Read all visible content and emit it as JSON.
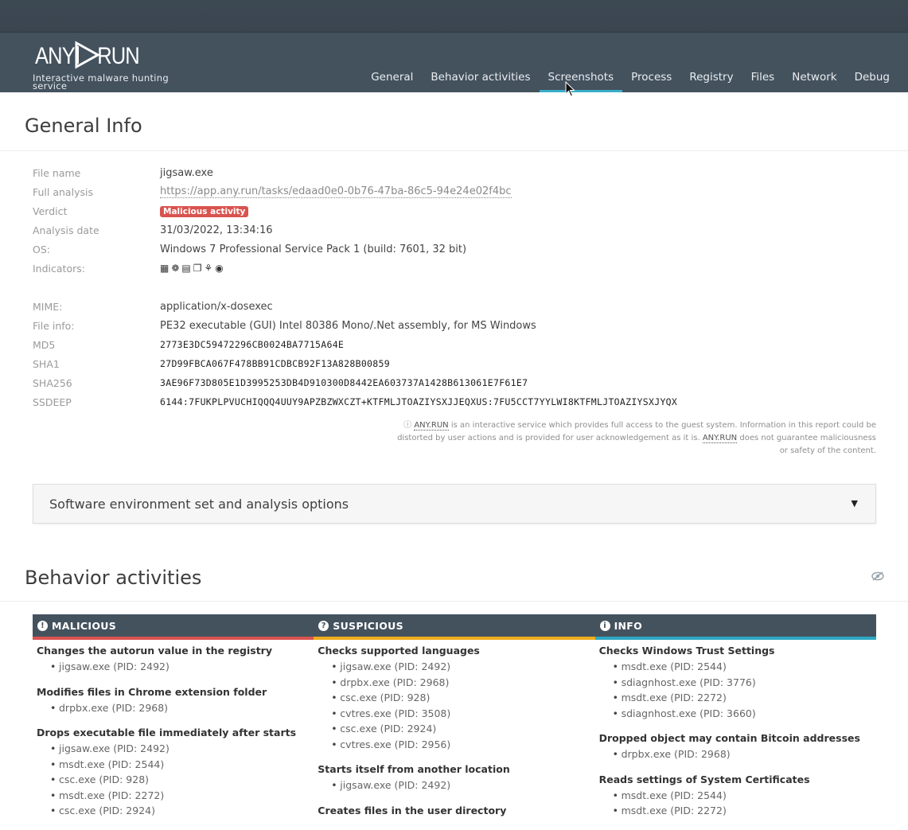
{
  "header": {
    "logo_text": "ANY RUN",
    "tagline_line1": "Interactive malware hunting",
    "tagline_line2": "service",
    "nav": [
      "General",
      "Behavior activities",
      "Screenshots",
      "Process",
      "Registry",
      "Files",
      "Network",
      "Debug"
    ],
    "active_nav": "Screenshots"
  },
  "general": {
    "title": "General Info",
    "rows": [
      {
        "label": "File name",
        "value": "jigsaw.exe"
      },
      {
        "label": "Full analysis",
        "value": "https://app.any.run/tasks/edaad0e0-0b76-47ba-86c5-94e24e02f4bc"
      },
      {
        "label": "Verdict",
        "value": "Malicious activity"
      },
      {
        "label": "Analysis date",
        "value": "31/03/2022, 13:34:16"
      },
      {
        "label": "OS:",
        "value": "Windows 7 Professional Service Pack 1 (build: 7601, 32 bit)"
      },
      {
        "label": "Indicators:",
        "value": ""
      },
      {
        "label": "MIME:",
        "value": "application/x-dosexec"
      },
      {
        "label": "File info:",
        "value": "PE32 executable (GUI) Intel 80386 Mono/.Net assembly, for MS Windows"
      },
      {
        "label": "MD5",
        "value": "2773E3DC59472296CB0024BA7715A64E"
      },
      {
        "label": "SHA1",
        "value": "27D99FBCA067F478BB91CDBCB92F13A828B00859"
      },
      {
        "label": "SHA256",
        "value": "3AE96F73D805E1D3995253DB4D910300D8442EA603737A1428B613061E7F61E7"
      },
      {
        "label": "SSDEEP",
        "value": "6144:7FUKPLPVUCHIQQQ4UUY9APZBZWXCZT+KTFMLJTOAZIYSXJJEQXUS:7FU5CCT7YYLWI8KTFMLJTOAZIYSXJYQX"
      }
    ],
    "indicator_icons": [
      "network-icon",
      "bug-icon",
      "executable-icon",
      "files-icon",
      "spy-icon",
      "eye-icon"
    ],
    "disclaimer_brand": "ANY.RUN",
    "disclaimer_part1": "is an interactive service which provides full access to the guest system. Information in this report could be distorted by user actions and is provided for user acknowledgement as it is.",
    "disclaimer_part2": "does not guarantee maliciousness or safety of the content."
  },
  "accordion": {
    "label": "Software environment set and analysis options"
  },
  "behavior": {
    "title": "Behavior activities",
    "columns": [
      {
        "title": "MALICIOUS",
        "icon": "!",
        "color": "#d9534f",
        "groups": [
          {
            "title": "Changes the autorun value in the registry",
            "items": [
              "jigsaw.exe (PID: 2492)"
            ]
          },
          {
            "title": "Modifies files in Chrome extension folder",
            "items": [
              "drpbx.exe (PID: 2968)"
            ]
          },
          {
            "title": "Drops executable file immediately after starts",
            "items": [
              "jigsaw.exe (PID: 2492)",
              "msdt.exe (PID: 2544)",
              "csc.exe (PID: 928)",
              "msdt.exe (PID: 2272)",
              "csc.exe (PID: 2924)"
            ]
          }
        ]
      },
      {
        "title": "SUSPICIOUS",
        "icon": "?",
        "color": "#f0ad1e",
        "groups": [
          {
            "title": "Checks supported languages",
            "items": [
              "jigsaw.exe (PID: 2492)",
              "drpbx.exe (PID: 2968)",
              "csc.exe (PID: 928)",
              "cvtres.exe (PID: 3508)",
              "csc.exe (PID: 2924)",
              "cvtres.exe (PID: 2956)"
            ]
          },
          {
            "title": "Starts itself from another location",
            "items": [
              "jigsaw.exe (PID: 2492)"
            ]
          },
          {
            "title": "Creates files in the user directory",
            "items": []
          }
        ]
      },
      {
        "title": "INFO",
        "icon": "i",
        "color": "#2ea7c3",
        "groups": [
          {
            "title": "Checks Windows Trust Settings",
            "items": [
              "msdt.exe (PID: 2544)",
              "sdiagnhost.exe (PID: 3776)",
              "msdt.exe (PID: 2272)",
              "sdiagnhost.exe (PID: 3660)"
            ]
          },
          {
            "title": "Dropped object may contain Bitcoin addresses",
            "items": [
              "drpbx.exe (PID: 2968)"
            ]
          },
          {
            "title": "Reads settings of System Certificates",
            "items": [
              "msdt.exe (PID: 2544)",
              "msdt.exe (PID: 2272)"
            ]
          }
        ]
      }
    ]
  }
}
